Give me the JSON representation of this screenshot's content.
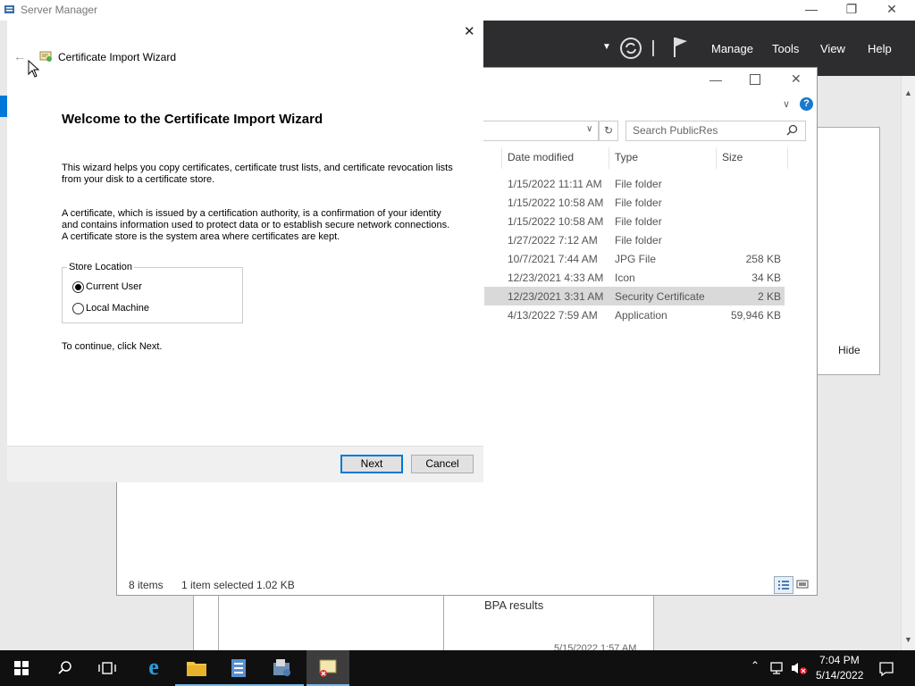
{
  "server_manager": {
    "title": "Server Manager",
    "menu": [
      "Manage",
      "Tools",
      "View",
      "Help"
    ],
    "hide_label": "Hide",
    "bpa_label": "BPA results",
    "partial_timestamp": "5/15/2022 1:57 AM"
  },
  "explorer": {
    "search_placeholder": "Search PublicRes",
    "columns": [
      "Date modified",
      "Type",
      "Size"
    ],
    "rows": [
      {
        "date": "1/15/2022 11:11 AM",
        "type": "File folder",
        "size": ""
      },
      {
        "date": "1/15/2022 10:58 AM",
        "type": "File folder",
        "size": ""
      },
      {
        "date": "1/15/2022 10:58 AM",
        "type": "File folder",
        "size": ""
      },
      {
        "date": "1/27/2022 7:12 AM",
        "type": "File folder",
        "size": ""
      },
      {
        "date": "10/7/2021 7:44 AM",
        "type": "JPG File",
        "size": "258 KB"
      },
      {
        "date": "12/23/2021 4:33 AM",
        "type": "Icon",
        "size": "34 KB"
      },
      {
        "date": "12/23/2021 3:31 AM",
        "type": "Security Certificate",
        "size": "2 KB"
      },
      {
        "date": "4/13/2022 7:59 AM",
        "type": "Application",
        "size": "59,946 KB"
      }
    ],
    "status_items": "8 items",
    "status_selected": "1 item selected  1.02 KB"
  },
  "wizard": {
    "title": "Certificate Import Wizard",
    "heading": "Welcome to the Certificate Import Wizard",
    "para1": "This wizard helps you copy certificates, certificate trust lists, and certificate revocation lists from your disk to a certificate store.",
    "para2": "A certificate, which is issued by a certification authority, is a confirmation of your identity and contains information used to protect data or to establish secure network connections. A certificate store is the system area where certificates are kept.",
    "store_location_label": "Store Location",
    "options": [
      "Current User",
      "Local Machine"
    ],
    "selected_option": "Current User",
    "continue_text": "To continue, click Next.",
    "next_label": "Next",
    "cancel_label": "Cancel"
  },
  "taskbar": {
    "time": "7:04 PM",
    "date": "5/14/2022"
  },
  "colors": {
    "accent": "#0078d7",
    "taskbar": "#101010",
    "sm_header": "#2d2d30"
  }
}
